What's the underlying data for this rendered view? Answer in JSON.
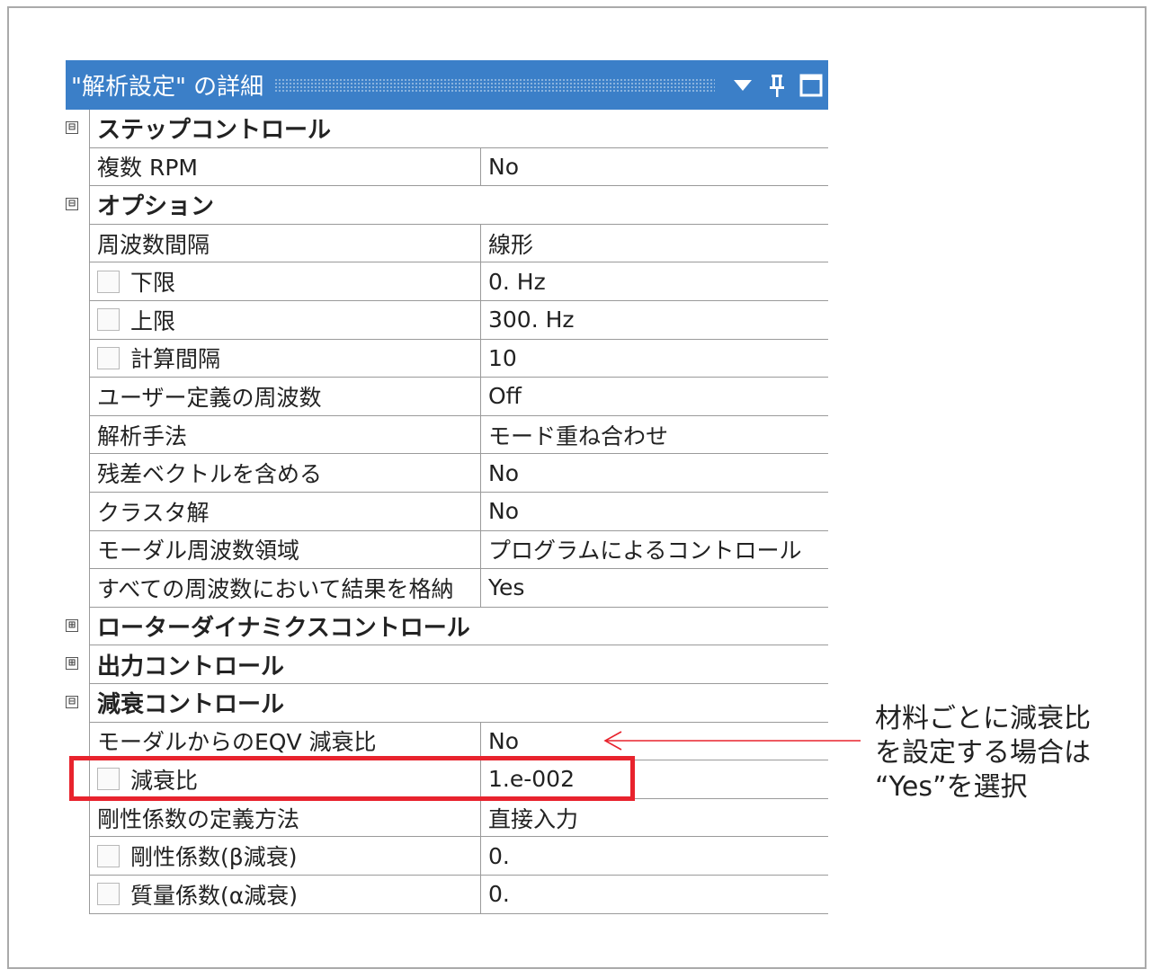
{
  "panel": {
    "title": "\"解析設定\" の詳細",
    "menu_icon": "triangle-down-icon",
    "pin_icon": "pin-icon",
    "maximize_icon": "square-icon"
  },
  "rows": [
    {
      "type": "group",
      "expander": "⊟",
      "label": "ステップコントロール"
    },
    {
      "type": "prop",
      "label": "複数 RPM",
      "value": "No"
    },
    {
      "type": "group",
      "expander": "⊟",
      "label": "オプション"
    },
    {
      "type": "prop",
      "label": "周波数間隔",
      "value": "線形"
    },
    {
      "type": "prop",
      "checkbox": true,
      "label": "下限",
      "value": "0. Hz"
    },
    {
      "type": "prop",
      "checkbox": true,
      "label": "上限",
      "value": "300. Hz"
    },
    {
      "type": "prop",
      "checkbox": true,
      "label": "計算間隔",
      "value": "10"
    },
    {
      "type": "prop",
      "label": "ユーザー定義の周波数",
      "value": "Off"
    },
    {
      "type": "prop",
      "label": "解析手法",
      "value": "モード重ね合わせ"
    },
    {
      "type": "prop",
      "label": "残差ベクトルを含める",
      "value": "No"
    },
    {
      "type": "prop",
      "label": "クラスタ解",
      "value": "No"
    },
    {
      "type": "prop",
      "label": "モーダル周波数領域",
      "value": "プログラムによるコントロール"
    },
    {
      "type": "prop",
      "label": "すべての周波数において結果を格納",
      "value": "Yes"
    },
    {
      "type": "group",
      "expander": "⊞",
      "label": "ローターダイナミクスコントロール"
    },
    {
      "type": "group",
      "expander": "⊞",
      "label": "出力コントロール"
    },
    {
      "type": "group",
      "expander": "⊟",
      "label": "減衰コントロール"
    },
    {
      "type": "prop",
      "label": "モーダルからのEQV 減衰比",
      "value": "No"
    },
    {
      "type": "prop",
      "checkbox": true,
      "label": "減衰比",
      "value": "1.e-002"
    },
    {
      "type": "prop",
      "label": "剛性係数の定義方法",
      "value": "直接入力"
    },
    {
      "type": "prop",
      "checkbox": true,
      "label": "剛性係数(β減衰)",
      "value": "0."
    },
    {
      "type": "prop",
      "checkbox": true,
      "label": "質量係数(α減衰)",
      "value": "0."
    }
  ],
  "annotation": {
    "lines": [
      "材料ごとに減衰比",
      "を設定する場合は",
      "“Yes”を選択"
    ],
    "highlight_color": "#e8232d",
    "arrow_color": "#e8232d"
  },
  "colors": {
    "title_bg": "#3b7fc8",
    "grid_line": "#9a9a9a"
  }
}
